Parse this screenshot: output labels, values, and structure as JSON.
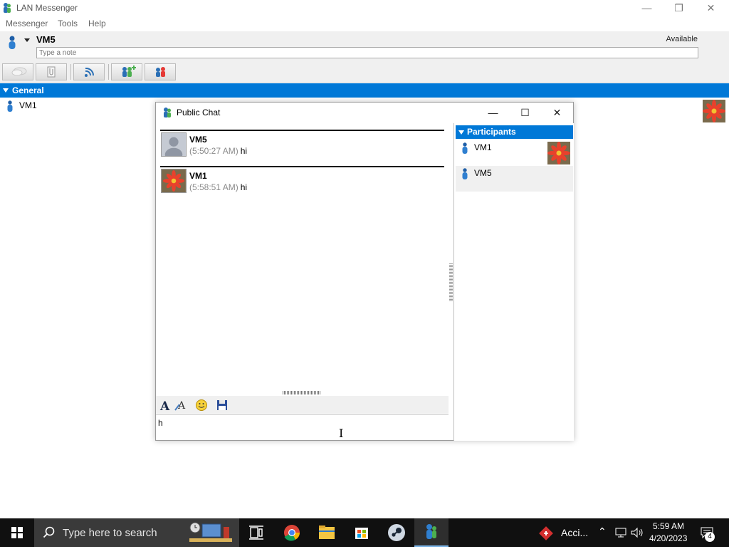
{
  "app": {
    "title": "LAN Messenger",
    "menu": [
      "Messenger",
      "Tools",
      "Help"
    ],
    "user": {
      "name": "VM5",
      "status": "Available",
      "note_placeholder": "Type a note"
    },
    "toolbar_icons": [
      "chat-bubble-icon",
      "file-icon",
      "broadcast-icon",
      "add-contact-icon",
      "groups-icon"
    ],
    "group": {
      "name": "General",
      "contacts": [
        {
          "name": "VM1"
        }
      ]
    }
  },
  "chat": {
    "title": "Public Chat",
    "messages": [
      {
        "sender": "VM5",
        "time": "(5:50:27 AM)",
        "text": "hi"
      },
      {
        "sender": "VM1",
        "time": "(5:58:51 AM)",
        "text": "hi"
      }
    ],
    "compose_text": "h",
    "participants_header": "Participants",
    "participants": [
      {
        "name": "VM1"
      },
      {
        "name": "VM5"
      }
    ]
  },
  "taskbar": {
    "search_placeholder": "Type here to search",
    "tray_app_label": "Acci...",
    "time": "5:59 AM",
    "date": "4/20/2023",
    "notification_count": "4"
  },
  "colors": {
    "accent": "#0078d7",
    "taskbar": "#101010"
  }
}
